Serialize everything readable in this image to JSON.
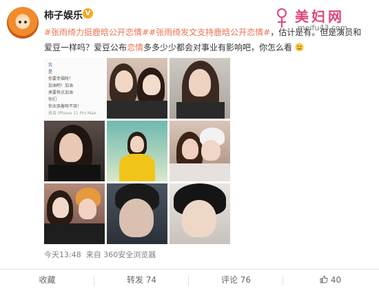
{
  "post": {
    "author": "柿子娱乐",
    "verified_badge": "V",
    "text": {
      "tag1": "#张雨绮力挺鹿晗公开恋情#",
      "tag2": "#张雨绮发文支持鹿晗公开恋情#",
      "part1": "，估计是有",
      "part2": "。但是演员和爱豆一样吗？爱豆公布",
      "kw": "恋情",
      "part3": "多多少少都会对事业有影响吧，你怎么看"
    },
    "screenshot_card": {
      "lines": [
        "我",
        "是",
        "你要幸福呀！",
        "加油吧！加油",
        "承要快点加油",
        "你们",
        "你太哭着呀不哭！",
        "来自 iPhone 11 Pro Max"
      ]
    },
    "meta": {
      "time": "今天13:48",
      "source_prefix": "来自",
      "source": "360安全浏览器"
    }
  },
  "watermark": {
    "title": "美妇网",
    "url": "meifu43.com"
  },
  "actions": {
    "favorite": "收藏",
    "repost": "转发 74",
    "comment": "评论 76",
    "like": "40"
  },
  "colors": {
    "accent": "#eb7350",
    "watermark": "#e0457b",
    "verified": "#f5a623"
  }
}
